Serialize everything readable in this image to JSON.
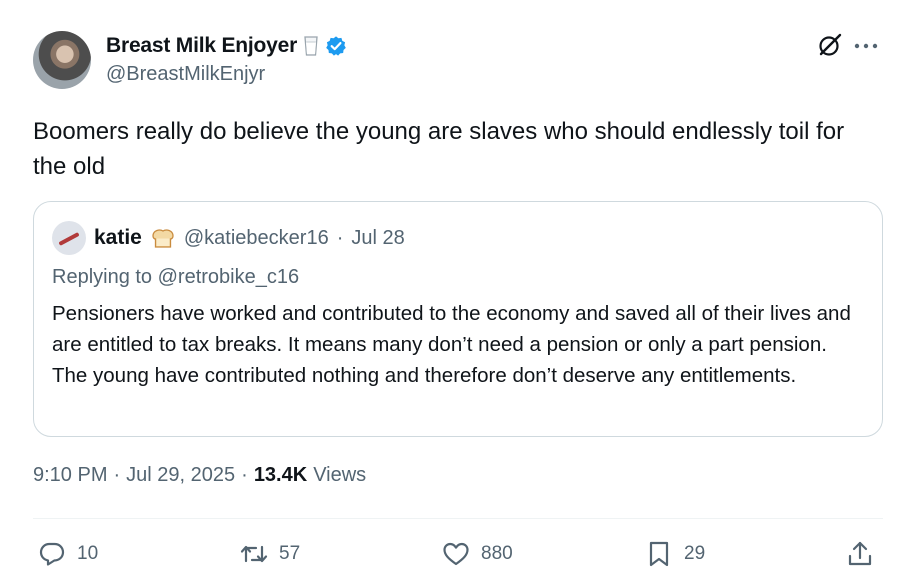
{
  "author": {
    "display_name": "Breast Milk Enjoyer",
    "handle": "@BreastMilkEnjyr",
    "emoji_icon": "milk-glass-icon",
    "verified_icon": "verified-badge-icon"
  },
  "tweet": {
    "text": "Boomers really do believe the young are slaves who should endlessly toil for the old"
  },
  "quoted": {
    "name": "katie",
    "emoji_icon": "bread-icon",
    "handle": "@katiebecker16",
    "separator": "·",
    "date": "Jul 28",
    "replying_to": "Replying to @retrobike_c16",
    "text": "Pensioners have worked and contributed to the economy and saved all of their lives and are entitled to tax breaks.  It means many don’t need a pension or only a part pension.  The young have contributed nothing and therefore don’t deserve any entitlements."
  },
  "meta": {
    "time": "9:10 PM",
    "dot1": "·",
    "date": "Jul 29, 2025",
    "dot2": "·",
    "views_count": "13.4K",
    "views_label": "Views"
  },
  "actions": {
    "replies": "10",
    "reposts": "57",
    "likes": "880",
    "bookmarks": "29"
  },
  "colors": {
    "text_primary": "#0f1419",
    "text_secondary": "#536471",
    "verified_blue": "#1d9bf0",
    "border": "#cfd9de"
  }
}
